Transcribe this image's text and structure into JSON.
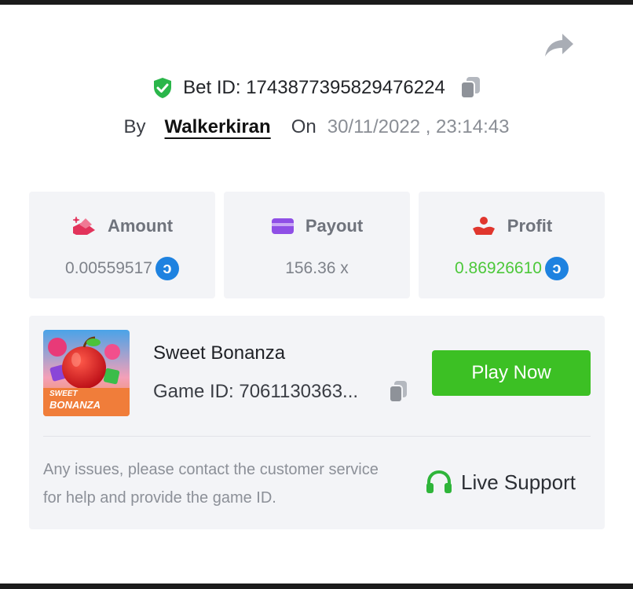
{
  "header": {
    "bet_id_label": "Bet ID: 1743877395829476224",
    "by_label": "By",
    "username": "Walkerkiran",
    "on_label": "On",
    "datetime": "30/11/2022 , 23:14:43"
  },
  "stats": {
    "amount": {
      "label": "Amount",
      "value": "0.00559517",
      "icon": "hand-coins-icon",
      "color": "#e2335b"
    },
    "payout": {
      "label": "Payout",
      "value": "156.36 x",
      "icon": "card-icon",
      "color": "#8f4fe6"
    },
    "profit": {
      "label": "Profit",
      "value": "0.86926610",
      "icon": "hand-heart-icon",
      "color": "#e0362e"
    }
  },
  "game": {
    "name": "Sweet Bonanza",
    "id_label": "Game ID: 7061130363...",
    "thumb_text_1": "SWEET",
    "thumb_text_2": "BONANZA",
    "play_label": "Play Now"
  },
  "support": {
    "issues_text": "Any issues, please contact the customer service for help and provide the game ID.",
    "live_support_label": "Live Support"
  },
  "colors": {
    "accent_green": "#3cc024",
    "profit_green": "#4cc83a",
    "coin_blue": "#1e82e0",
    "card_bg": "#f3f4f7"
  }
}
